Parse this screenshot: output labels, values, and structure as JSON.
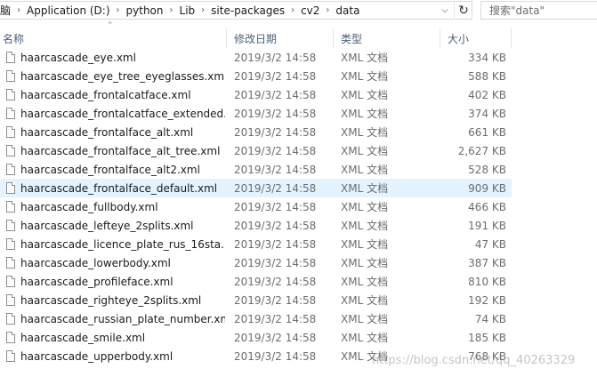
{
  "address": {
    "crumbs": [
      "脑",
      "Application (D:)",
      "python",
      "Lib",
      "site-packages",
      "cv2",
      "data"
    ],
    "refresh_icon": "refresh-icon",
    "dropdown_icon": "chevron-down-icon"
  },
  "search": {
    "placeholder": "搜索\"data\""
  },
  "columns": {
    "name": "名称",
    "date": "修改日期",
    "type": "类型",
    "size": "大小"
  },
  "files": [
    {
      "name": "haarcascade_eye.xml",
      "date": "2019/3/2 14:58",
      "type": "XML 文档",
      "size": "334 KB"
    },
    {
      "name": "haarcascade_eye_tree_eyeglasses.xml",
      "date": "2019/3/2 14:58",
      "type": "XML 文档",
      "size": "588 KB"
    },
    {
      "name": "haarcascade_frontalcatface.xml",
      "date": "2019/3/2 14:58",
      "type": "XML 文档",
      "size": "402 KB"
    },
    {
      "name": "haarcascade_frontalcatface_extended...",
      "date": "2019/3/2 14:58",
      "type": "XML 文档",
      "size": "374 KB"
    },
    {
      "name": "haarcascade_frontalface_alt.xml",
      "date": "2019/3/2 14:58",
      "type": "XML 文档",
      "size": "661 KB"
    },
    {
      "name": "haarcascade_frontalface_alt_tree.xml",
      "date": "2019/3/2 14:58",
      "type": "XML 文档",
      "size": "2,627 KB"
    },
    {
      "name": "haarcascade_frontalface_alt2.xml",
      "date": "2019/3/2 14:58",
      "type": "XML 文档",
      "size": "528 KB"
    },
    {
      "name": "haarcascade_frontalface_default.xml",
      "date": "2019/3/2 14:58",
      "type": "XML 文档",
      "size": "909 KB"
    },
    {
      "name": "haarcascade_fullbody.xml",
      "date": "2019/3/2 14:58",
      "type": "XML 文档",
      "size": "466 KB"
    },
    {
      "name": "haarcascade_lefteye_2splits.xml",
      "date": "2019/3/2 14:58",
      "type": "XML 文档",
      "size": "191 KB"
    },
    {
      "name": "haarcascade_licence_plate_rus_16sta...",
      "date": "2019/3/2 14:58",
      "type": "XML 文档",
      "size": "47 KB"
    },
    {
      "name": "haarcascade_lowerbody.xml",
      "date": "2019/3/2 14:58",
      "type": "XML 文档",
      "size": "387 KB"
    },
    {
      "name": "haarcascade_profileface.xml",
      "date": "2019/3/2 14:58",
      "type": "XML 文档",
      "size": "810 KB"
    },
    {
      "name": "haarcascade_righteye_2splits.xml",
      "date": "2019/3/2 14:58",
      "type": "XML 文档",
      "size": "192 KB"
    },
    {
      "name": "haarcascade_russian_plate_number.xml",
      "date": "2019/3/2 14:58",
      "type": "XML 文档",
      "size": "74 KB"
    },
    {
      "name": "haarcascade_smile.xml",
      "date": "2019/3/2 14:58",
      "type": "XML 文档",
      "size": "185 KB"
    },
    {
      "name": "haarcascade_upperbody.xml",
      "date": "2019/3/2 14:58",
      "type": "XML 文档",
      "size": "768 KB"
    }
  ],
  "watermark": "https://blog.csdn.net/qq_40263329",
  "colors": {
    "selected_row": "#e5f3ff",
    "header_text": "#4c607a"
  }
}
